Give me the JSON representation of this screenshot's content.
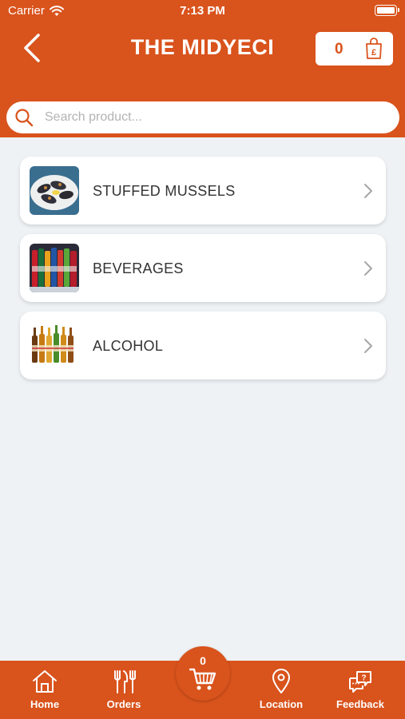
{
  "status": {
    "carrier": "Carrier",
    "time": "7:13 PM"
  },
  "header": {
    "title": "THE MIDYECI",
    "cart_count": "0",
    "currency_symbol": "£"
  },
  "search": {
    "placeholder": "Search product..."
  },
  "categories": [
    {
      "label": "STUFFED MUSSELS",
      "icon": "mussels-thumb"
    },
    {
      "label": "BEVERAGES",
      "icon": "beverages-thumb"
    },
    {
      "label": "ALCOHOL",
      "icon": "alcohol-thumb"
    }
  ],
  "nav": {
    "home": "Home",
    "orders": "Orders",
    "cart_count": "0",
    "location": "Location",
    "feedback": "Feedback"
  },
  "colors": {
    "accent": "#d9531c",
    "background": "#eef2f5",
    "card": "#ffffff"
  }
}
